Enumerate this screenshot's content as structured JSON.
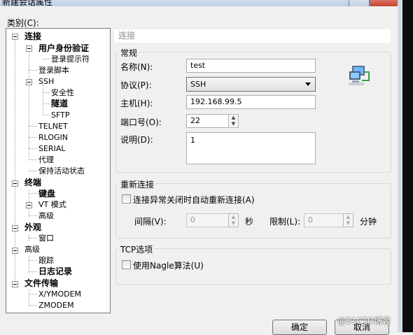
{
  "window": {
    "title": "新建会话属性"
  },
  "category_label": "类别(C):",
  "tree": {
    "connection": "连接",
    "auth": "用户身份验证",
    "login_prompt": "登录提示符",
    "login_script": "登录脚本",
    "ssh": "SSH",
    "security": "安全性",
    "tunnel": "隧道",
    "sftp": "SFTP",
    "telnet": "TELNET",
    "rlogin": "RLOGIN",
    "serial": "SERIAL",
    "proxy": "代理",
    "keepalive": "保持活动状态",
    "terminal": "终端",
    "keyboard": "键盘",
    "vt_mode": "VT 模式",
    "advanced1": "高级",
    "appearance": "外观",
    "window": "窗口",
    "advanced2": "高级",
    "trace": "跟踪",
    "logging": "日志记录",
    "file_transfer": "文件传输",
    "xymodem": "X/YMODEM",
    "zmodem": "ZMODEM"
  },
  "panel_title": "连接",
  "general": {
    "group": "常规",
    "name_label": "名称(N):",
    "name_value": "test",
    "protocol_label": "协议(P):",
    "protocol_value": "SSH",
    "host_label": "主机(H):",
    "host_value": "192.168.99.5",
    "port_label": "端口号(O):",
    "port_value": "22",
    "desc_label": "说明(D):",
    "desc_value": "1"
  },
  "reconnect": {
    "group": "重新连接",
    "auto_label": "连接异常关闭时自动重新连接(A)",
    "interval_label": "间隔(V):",
    "interval_value": "0",
    "seconds": "秒",
    "limit_label": "限制(L):",
    "limit_value": "0",
    "minutes": "分钟"
  },
  "tcp": {
    "group": "TCP选项",
    "nagle_label": "使用Nagle算法(U)"
  },
  "buttons": {
    "ok": "确定",
    "cancel": "取消"
  },
  "watermark": "@51CTO博客"
}
